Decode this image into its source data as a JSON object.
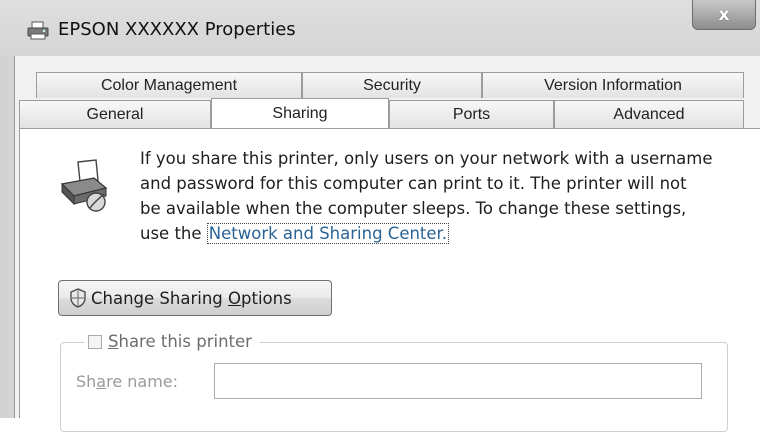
{
  "window": {
    "title": "EPSON XXXXXX Properties",
    "close_glyph": "x",
    "icon": "printer-icon"
  },
  "tabs": {
    "row1": [
      "Color Management",
      "Security",
      "Version Information"
    ],
    "row2": [
      "General",
      "Sharing",
      "Ports",
      "Advanced"
    ],
    "active": "Sharing"
  },
  "sharing": {
    "info_lines": [
      "If you share this printer, only users on your network with a username",
      "and password for this computer can print to it. The printer will not",
      "be available when the computer sleeps. To change these settings,"
    ],
    "info_last_prefix": "use the ",
    "link_text": "Network and Sharing Center.",
    "change_button": {
      "before": "Change Sharing ",
      "accel": "O",
      "after": "ptions",
      "icon": "shield-icon"
    },
    "share_checkbox": {
      "accel": "S",
      "after": "hare this printer",
      "checked": false
    },
    "share_name": {
      "before": "Sh",
      "accel": "a",
      "after": "re name:",
      "value": ""
    }
  },
  "colors": {
    "link": "#2a6496",
    "disabled_text": "#9a9a9a"
  }
}
